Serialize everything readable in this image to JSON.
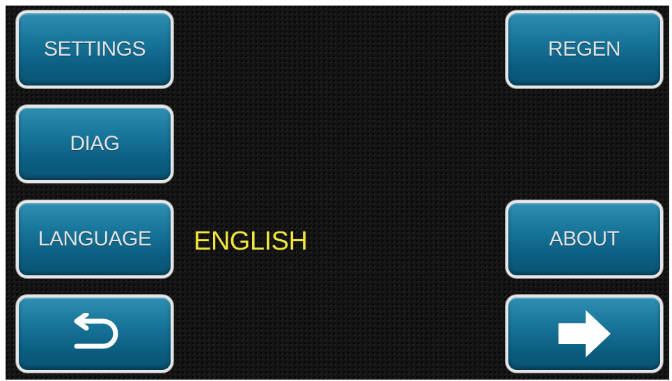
{
  "buttons": {
    "settings": "SETTINGS",
    "diag": "DIAG",
    "language": "LANGUAGE",
    "regen": "REGEN",
    "about": "ABOUT"
  },
  "language": {
    "current": "ENGLISH",
    "color": "#f2e43a"
  },
  "icons": {
    "back": "return-arrow-icon",
    "next": "right-arrow-icon"
  },
  "colors": {
    "button": "#0b5d80",
    "button_border": "#e6e6e6",
    "button_text": "#e2e2e2",
    "background": "#141414"
  }
}
